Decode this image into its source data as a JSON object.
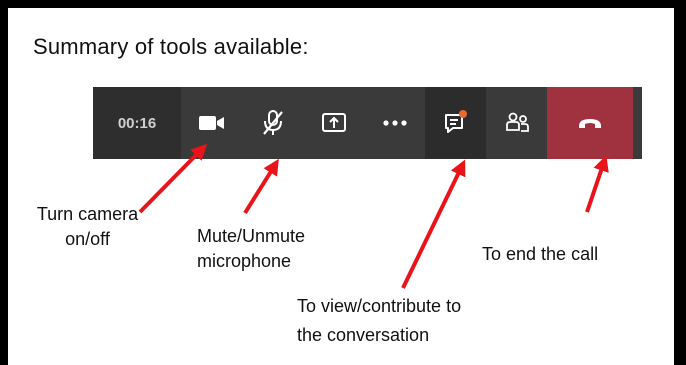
{
  "heading": "Summary of tools available:",
  "toolbar": {
    "timer": "00:16",
    "buttons": [
      {
        "name": "camera",
        "icon": "camera-icon"
      },
      {
        "name": "mute",
        "icon": "microphone-off-icon"
      },
      {
        "name": "share",
        "icon": "share-screen-icon"
      },
      {
        "name": "more",
        "icon": "more-dots-icon"
      },
      {
        "name": "chat",
        "icon": "chat-icon",
        "badge": "notification-dot"
      },
      {
        "name": "participants",
        "icon": "participants-icon"
      },
      {
        "name": "end-call",
        "icon": "hang-up-icon"
      }
    ],
    "colors": {
      "bar": "#3a3a3a",
      "timer_bg": "#2e2e2e",
      "end_call": "#a0313f",
      "badge": "#e86a2f",
      "arrow": "#e8141a"
    }
  },
  "annotations": {
    "camera_line1": "Turn camera",
    "camera_line2": "on/off",
    "mute_line1": "Mute/Unmute",
    "mute_line2": "microphone",
    "end_call": "To end the call",
    "conversation_line1": "To view/contribute to",
    "conversation_line2": "the conversation"
  }
}
